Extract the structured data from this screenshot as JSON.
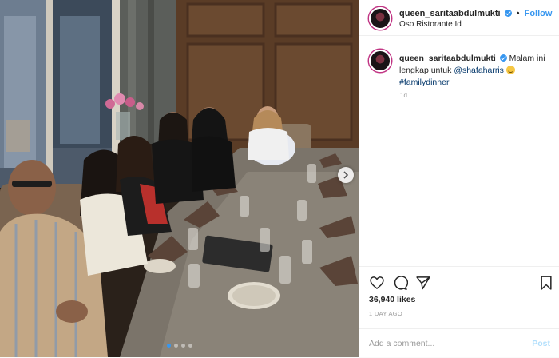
{
  "photo": {
    "alt_subject": "group dinner photo",
    "slide_count": 4,
    "active_slide": 1
  },
  "header": {
    "username": "queen_saritaabdulmukti",
    "separator": "•",
    "follow_label": "Follow",
    "location": "Oso Ristorante Id"
  },
  "caption": {
    "username": "queen_saritaabdulmukti",
    "text_before_mention": "Malam ini lengkap untuk ",
    "mention": "@shafaharris",
    "hashtag": "#familydinner",
    "time": "1d"
  },
  "footer": {
    "likes": "36,940 likes",
    "time_ago": "1 DAY AGO",
    "comment_placeholder": "Add a comment...",
    "post_label": "Post"
  },
  "colors": {
    "accent": "#3897f0",
    "link": "#003569",
    "post_disabled": "#b2dffc"
  },
  "icons": [
    "chevron-right-icon",
    "verified-icon",
    "heart-icon",
    "comment-icon",
    "share-icon",
    "bookmark-icon",
    "smile-emoji-icon"
  ]
}
